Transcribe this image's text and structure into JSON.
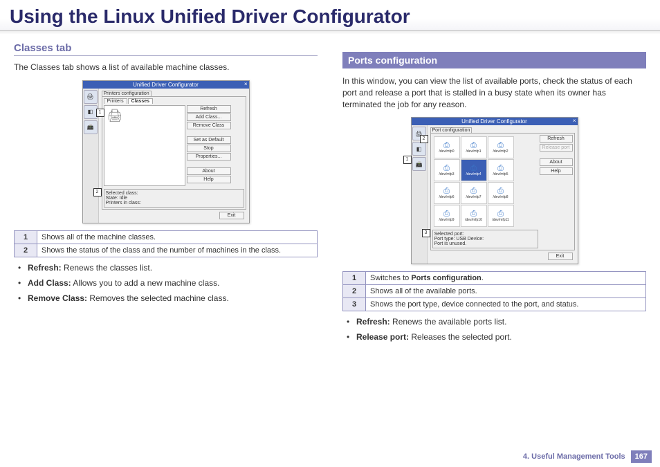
{
  "page_title": "Using the Linux Unified Driver Configurator",
  "left": {
    "heading": "Classes tab",
    "intro": "The Classes tab shows a list of available machine classes.",
    "screenshot": {
      "window_title": "Unified Driver Configurator",
      "section_title": "Printers configuration",
      "tabs": [
        "Printers",
        "Classes"
      ],
      "active_tab_index": 1,
      "buttons_group1": [
        "Refresh",
        "Add Class...",
        "Remove Class"
      ],
      "buttons_group2": [
        "Set as Default",
        "Stop",
        "Properties..."
      ],
      "buttons_group3": [
        "About",
        "Help"
      ],
      "selected_box_title": "Selected class:",
      "selected_box_line1": "State: Idle",
      "selected_box_line2": "Printers in class:",
      "exit": "Exit",
      "callout1": "1",
      "callout2": "2"
    },
    "table": [
      {
        "num": "1",
        "text": "Shows all of the machine classes."
      },
      {
        "num": "2",
        "text": "Shows the status of the class and the number of machines in the class."
      }
    ],
    "bullets": [
      {
        "label": "Refresh:",
        "text": " Renews the classes list."
      },
      {
        "label": "Add Class:",
        "text": " Allows you to add a new machine class."
      },
      {
        "label": "Remove Class:",
        "text": " Removes the selected machine class."
      }
    ]
  },
  "right": {
    "heading": "Ports configuration",
    "intro": "In this window, you can view the list of available ports, check the status of each port and release a port that is stalled in a busy state when its owner has terminated the job for any reason.",
    "screenshot": {
      "window_title": "Unified Driver Configurator",
      "section_title": "Port configuration",
      "ports": [
        "/dev/mfp0",
        "/dev/mfp1",
        "/dev/mfp2",
        "/dev/mfp3",
        "/dev/mfp4",
        "/dev/mfp5",
        "/dev/mfp6",
        "/dev/mfp7",
        "/dev/mfp8",
        "/dev/mfp9",
        "/dev/mfp10",
        "/dev/mfp11"
      ],
      "selected_index": 4,
      "buttons": [
        "Refresh",
        "Release port",
        "About",
        "Help"
      ],
      "selected_box_title": "Selected port:",
      "selected_box_line1": "Port type: USB   Device:",
      "selected_box_line2": "Port is unused.",
      "exit": "Exit",
      "callout1": "1",
      "callout2": "2",
      "callout3": "3"
    },
    "table": [
      {
        "num": "1",
        "text_pre": "Switches to ",
        "text_bold": "Ports configuration",
        "text_post": "."
      },
      {
        "num": "2",
        "text_pre": "Shows all of the available ports.",
        "text_bold": "",
        "text_post": ""
      },
      {
        "num": "3",
        "text_pre": "Shows the port type, device connected to the port, and status.",
        "text_bold": "",
        "text_post": ""
      }
    ],
    "bullets": [
      {
        "label": "Refresh:",
        "text": " Renews the available ports list."
      },
      {
        "label": "Release port:",
        "text": " Releases the selected port."
      }
    ]
  },
  "footer": {
    "chapter": "4.  Useful Management Tools",
    "page": "167"
  }
}
